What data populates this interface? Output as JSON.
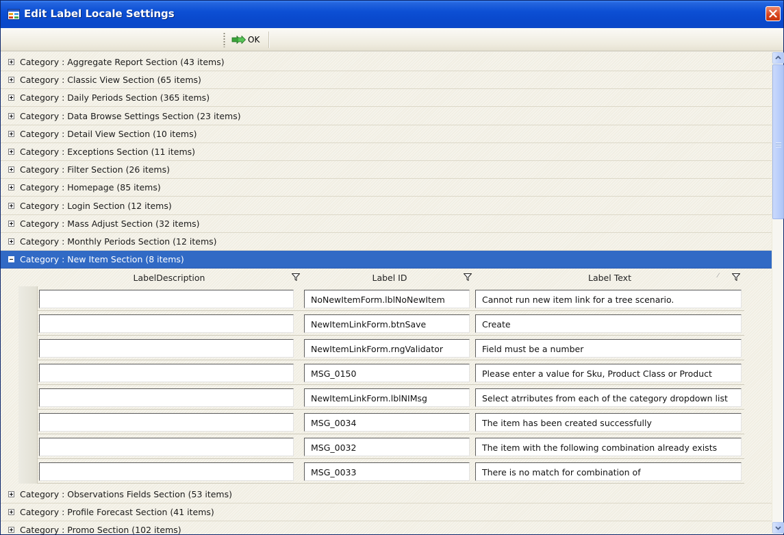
{
  "window": {
    "title": "Edit Label Locale Settings"
  },
  "toolbar": {
    "ok_label": "OK"
  },
  "categories_before": [
    {
      "label": "Category : Aggregate Report Section (43 items)"
    },
    {
      "label": "Category : Classic View Section (65 items)"
    },
    {
      "label": "Category : Daily Periods Section (365 items)"
    },
    {
      "label": "Category : Data Browse Settings Section (23 items)"
    },
    {
      "label": "Category : Detail View Section (10 items)"
    },
    {
      "label": "Category : Exceptions Section (11 items)"
    },
    {
      "label": "Category : Filter Section (26 items)"
    },
    {
      "label": "Category : Homepage (85 items)"
    },
    {
      "label": "Category : Login Section (12 items)"
    },
    {
      "label": "Category : Mass Adjust Section (32 items)"
    },
    {
      "label": "Category : Monthly Periods Section (12 items)"
    }
  ],
  "expanded_category": {
    "label": "Category : New Item Section (8 items)",
    "columns": [
      "LabelDescription",
      "Label ID",
      "Label Text"
    ],
    "rows": [
      {
        "description": "",
        "label_id": "NoNewItemForm.lblNoNewItem",
        "label_text": "Cannot run new item link for a tree scenario."
      },
      {
        "description": "",
        "label_id": "NewItemLinkForm.btnSave",
        "label_text": "Create"
      },
      {
        "description": "",
        "label_id": "NewItemLinkForm.rngValidator",
        "label_text": "Field must be a number"
      },
      {
        "description": "",
        "label_id": "MSG_0150",
        "label_text": "Please enter a value for Sku, Product Class or Product"
      },
      {
        "description": "",
        "label_id": "NewItemLinkForm.lblNIMsg",
        "label_text": "Select atrributes from each of the category dropdown list"
      },
      {
        "description": "",
        "label_id": "MSG_0034",
        "label_text": "The item has been created successfully"
      },
      {
        "description": "",
        "label_id": "MSG_0032",
        "label_text": "The item with the following combination already exists"
      },
      {
        "description": "",
        "label_id": "MSG_0033",
        "label_text": "There is no match for combination of"
      }
    ]
  },
  "categories_after": [
    {
      "label": "Category : Observations Fields Section (53 items)"
    },
    {
      "label": "Category : Profile Forecast Section (41 items)"
    },
    {
      "label": "Category : Promo Section (102 items)"
    }
  ],
  "icons": {
    "title": "app-window-icon",
    "close": "close-icon",
    "ok": "double-arrow-right-icon",
    "filter": "funnel-filter-icon",
    "expand": "plus-box-icon",
    "collapse": "minus-box-icon"
  },
  "colors": {
    "title_bar": "#0c4fd4",
    "selected_row": "#316ac5",
    "close_button": "#d6421c",
    "ok_arrow": "#3aa23a"
  }
}
